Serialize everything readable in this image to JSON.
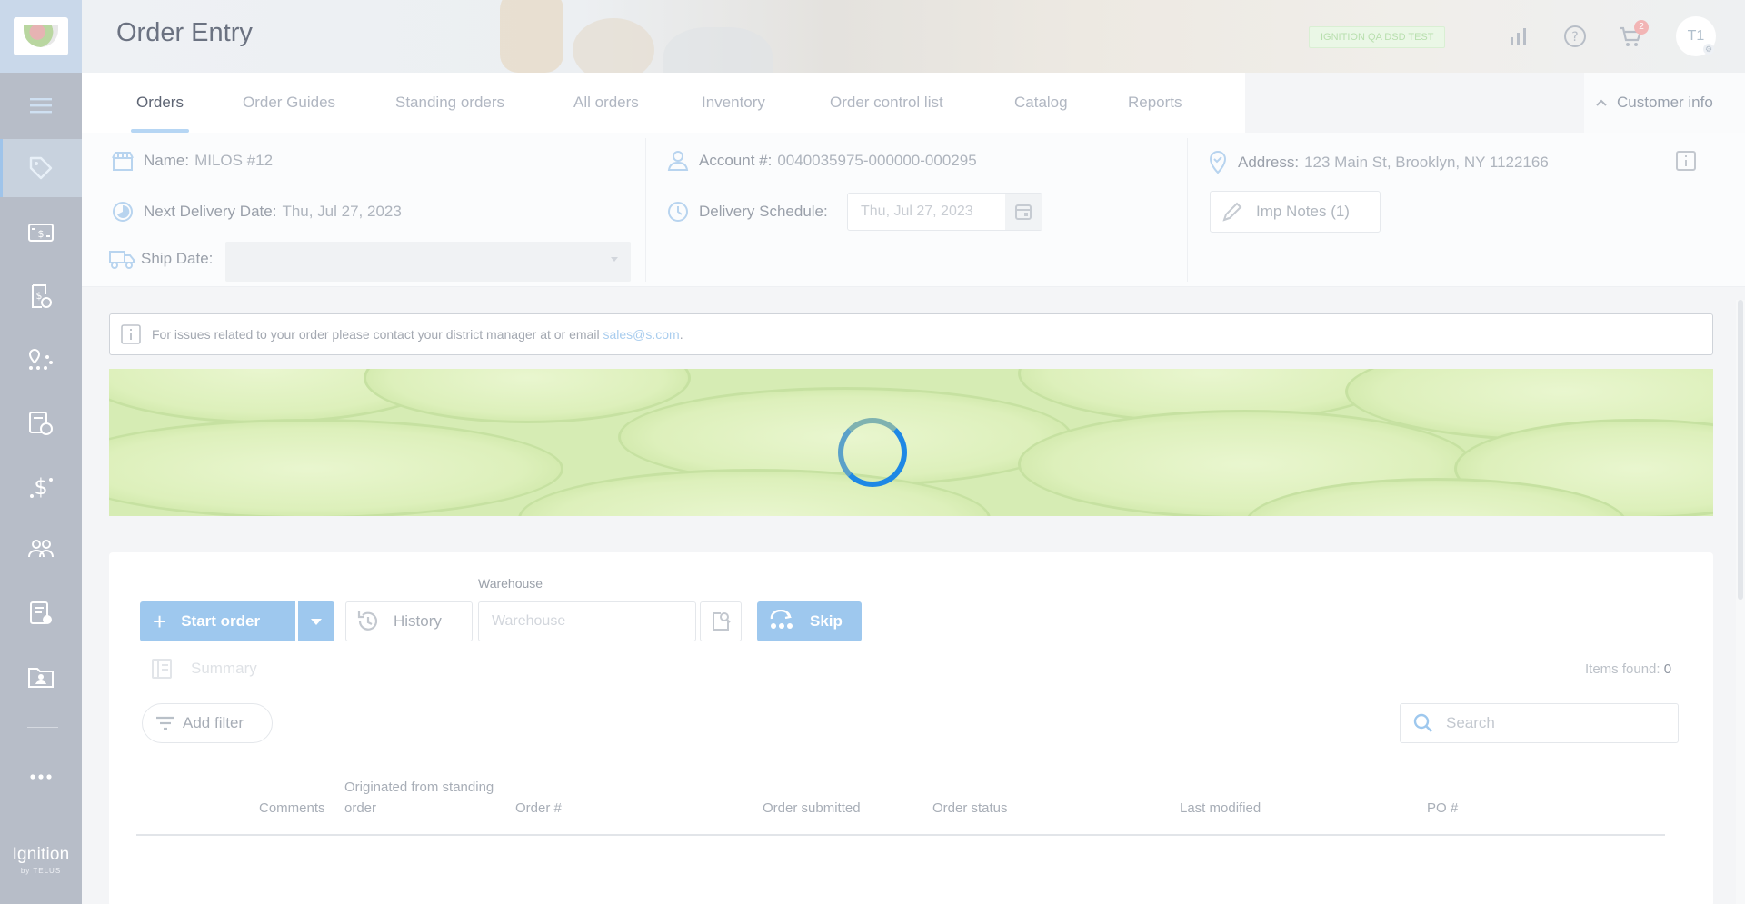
{
  "header": {
    "title": "Order Entry",
    "env_badge": "IGNITION QA DSD TEST",
    "cart_count": "2",
    "avatar_initials": "T1"
  },
  "sidebar": {
    "brand_name": "Ignition",
    "brand_sub": "by TELUS"
  },
  "tabs": [
    {
      "label": "Orders",
      "active": true
    },
    {
      "label": "Order Guides"
    },
    {
      "label": "Standing orders"
    },
    {
      "label": "All orders"
    },
    {
      "label": "Inventory"
    },
    {
      "label": "Order control list"
    },
    {
      "label": "Catalog"
    },
    {
      "label": "Reports"
    }
  ],
  "customer_info_label": "Customer info",
  "customer": {
    "name_label": "Name:",
    "name": "MILOS #12",
    "next_delivery_label": "Next Delivery Date:",
    "next_delivery": "Thu, Jul 27, 2023",
    "ship_date_label": "Ship Date:",
    "account_label": "Account #:",
    "account": "0040035975-000000-000295",
    "delivery_schedule_label": "Delivery Schedule:",
    "delivery_schedule": "Thu, Jul 27, 2023",
    "address_label": "Address:",
    "address": "123 Main St, Brooklyn, NY 1122166",
    "imp_notes": "Imp Notes (1)"
  },
  "notice": {
    "text": "For issues related to your order please contact your district manager at or email",
    "email": "sales@s.com",
    "end": "."
  },
  "orders": {
    "warehouse_label": "Warehouse",
    "warehouse_placeholder": "Warehouse",
    "start_order": "Start order",
    "history": "History",
    "skip": "Skip",
    "summary": "Summary",
    "items_found_label": "Items found:",
    "items_found": "0",
    "add_filter": "Add filter",
    "search_placeholder": "Search",
    "columns": {
      "comments": "Comments",
      "originated_1": "Originated from standing",
      "originated_2": "order",
      "order_no": "Order #",
      "submitted": "Order submitted",
      "status": "Order status",
      "modified": "Last modified",
      "po": "PO #"
    }
  },
  "colors": {
    "accent": "#1e88e5",
    "button": "#9ec8ee",
    "sidebar": "#b7bdc8"
  }
}
